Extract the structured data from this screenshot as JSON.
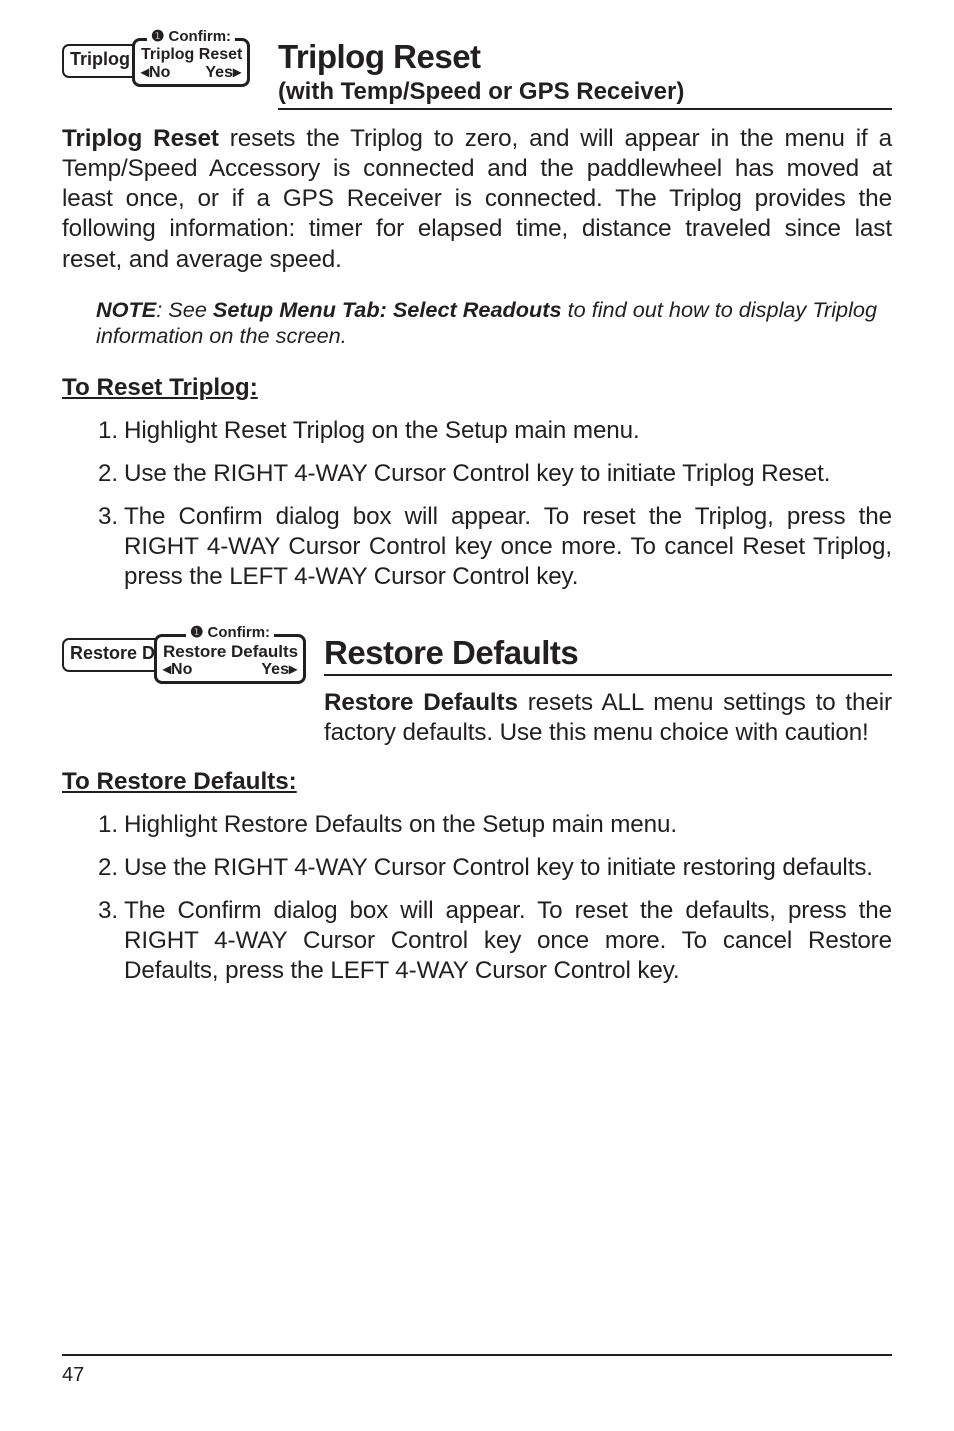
{
  "section1": {
    "dialog": {
      "back_label": "Triplog Rese",
      "tab": "❶ Confirm:",
      "middle": "Triplog Reset",
      "left": "◂No",
      "right": "Yes▸"
    },
    "title": "Triplog Reset",
    "subtitle": "(with Temp/Speed or GPS Receiver)",
    "para_lead": "Triplog Reset",
    "para_rest": " resets the Triplog to zero, and will appear in the menu if a Temp/Speed Accessory is connected and the paddlewheel has moved at least once, or if a GPS Receiver is connected. The Triplog provides the following information: timer for elapsed time, distance traveled since last reset, and average speed.",
    "note_lead": "NOTE",
    "note_mid_pre": ":  See ",
    "note_bold": "Setup Menu Tab: Select Readouts",
    "note_mid_post": " to find out how to display Triplog information on the screen.",
    "proc": "To Reset Triplog:",
    "steps": [
      "Highlight Reset Triplog on the Setup main menu.",
      "Use the RIGHT 4-WAY Cursor Control key to initiate Triplog Reset.",
      "The Confirm dialog box will appear. To reset the Triplog, press the RIGHT 4-WAY Cursor Control key once more. To cancel Reset Triplog, press the LEFT 4-WAY Cursor Control key."
    ]
  },
  "section2": {
    "dialog": {
      "back_label": "Restore De",
      "tab": "❶ Confirm:",
      "middle": "Restore Defaults",
      "left": "◂No",
      "right": "Yes▸"
    },
    "title": "Restore Defaults",
    "para_lead": "Restore Defaults",
    "para_rest": " resets ALL menu settings to their factory defaults. Use this menu choice with caution!",
    "proc": "To Restore Defaults:",
    "steps": [
      "Highlight Restore Defaults on the Setup main menu.",
      "Use the RIGHT 4-WAY Cursor Control key to initiate restoring defaults.",
      "The Confirm dialog box will appear. To reset the defaults,  press the RIGHT 4-WAY Cursor Control key once more. To cancel Restore Defaults, press the LEFT 4-WAY Cursor Control key."
    ]
  },
  "page_number": "47"
}
